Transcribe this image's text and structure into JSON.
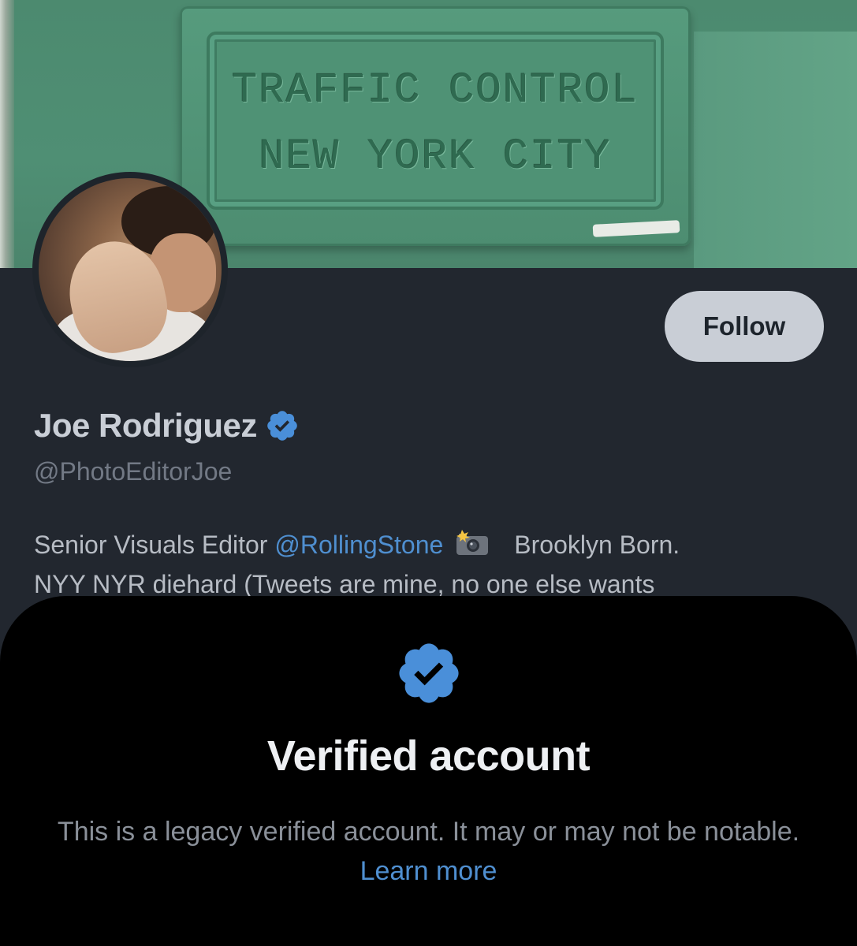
{
  "banner": {
    "sign_line_1": "TRAFFIC CONTROL",
    "sign_line_2": "NEW YORK CITY"
  },
  "profile": {
    "display_name": "Joe Rodriguez",
    "handle": "@PhotoEditorJoe",
    "follow_label": "Follow",
    "verified_icon": "verified-badge-icon",
    "bio": {
      "line1_prefix": "Senior Visuals Editor",
      "mention": "@RollingStone",
      "line1_suffix": "Brooklyn Born.",
      "line2": "NYY NYR diehard (Tweets are mine, no one else wants"
    }
  },
  "verified_sheet": {
    "title": "Verified account",
    "body": "This is a legacy verified account. It may or may not be notable.",
    "link_label": "Learn more"
  },
  "colors": {
    "background": "#22272f",
    "sheet_background": "#000000",
    "accent_blue": "#4f8fd0",
    "follow_button": "#c9ced6"
  }
}
